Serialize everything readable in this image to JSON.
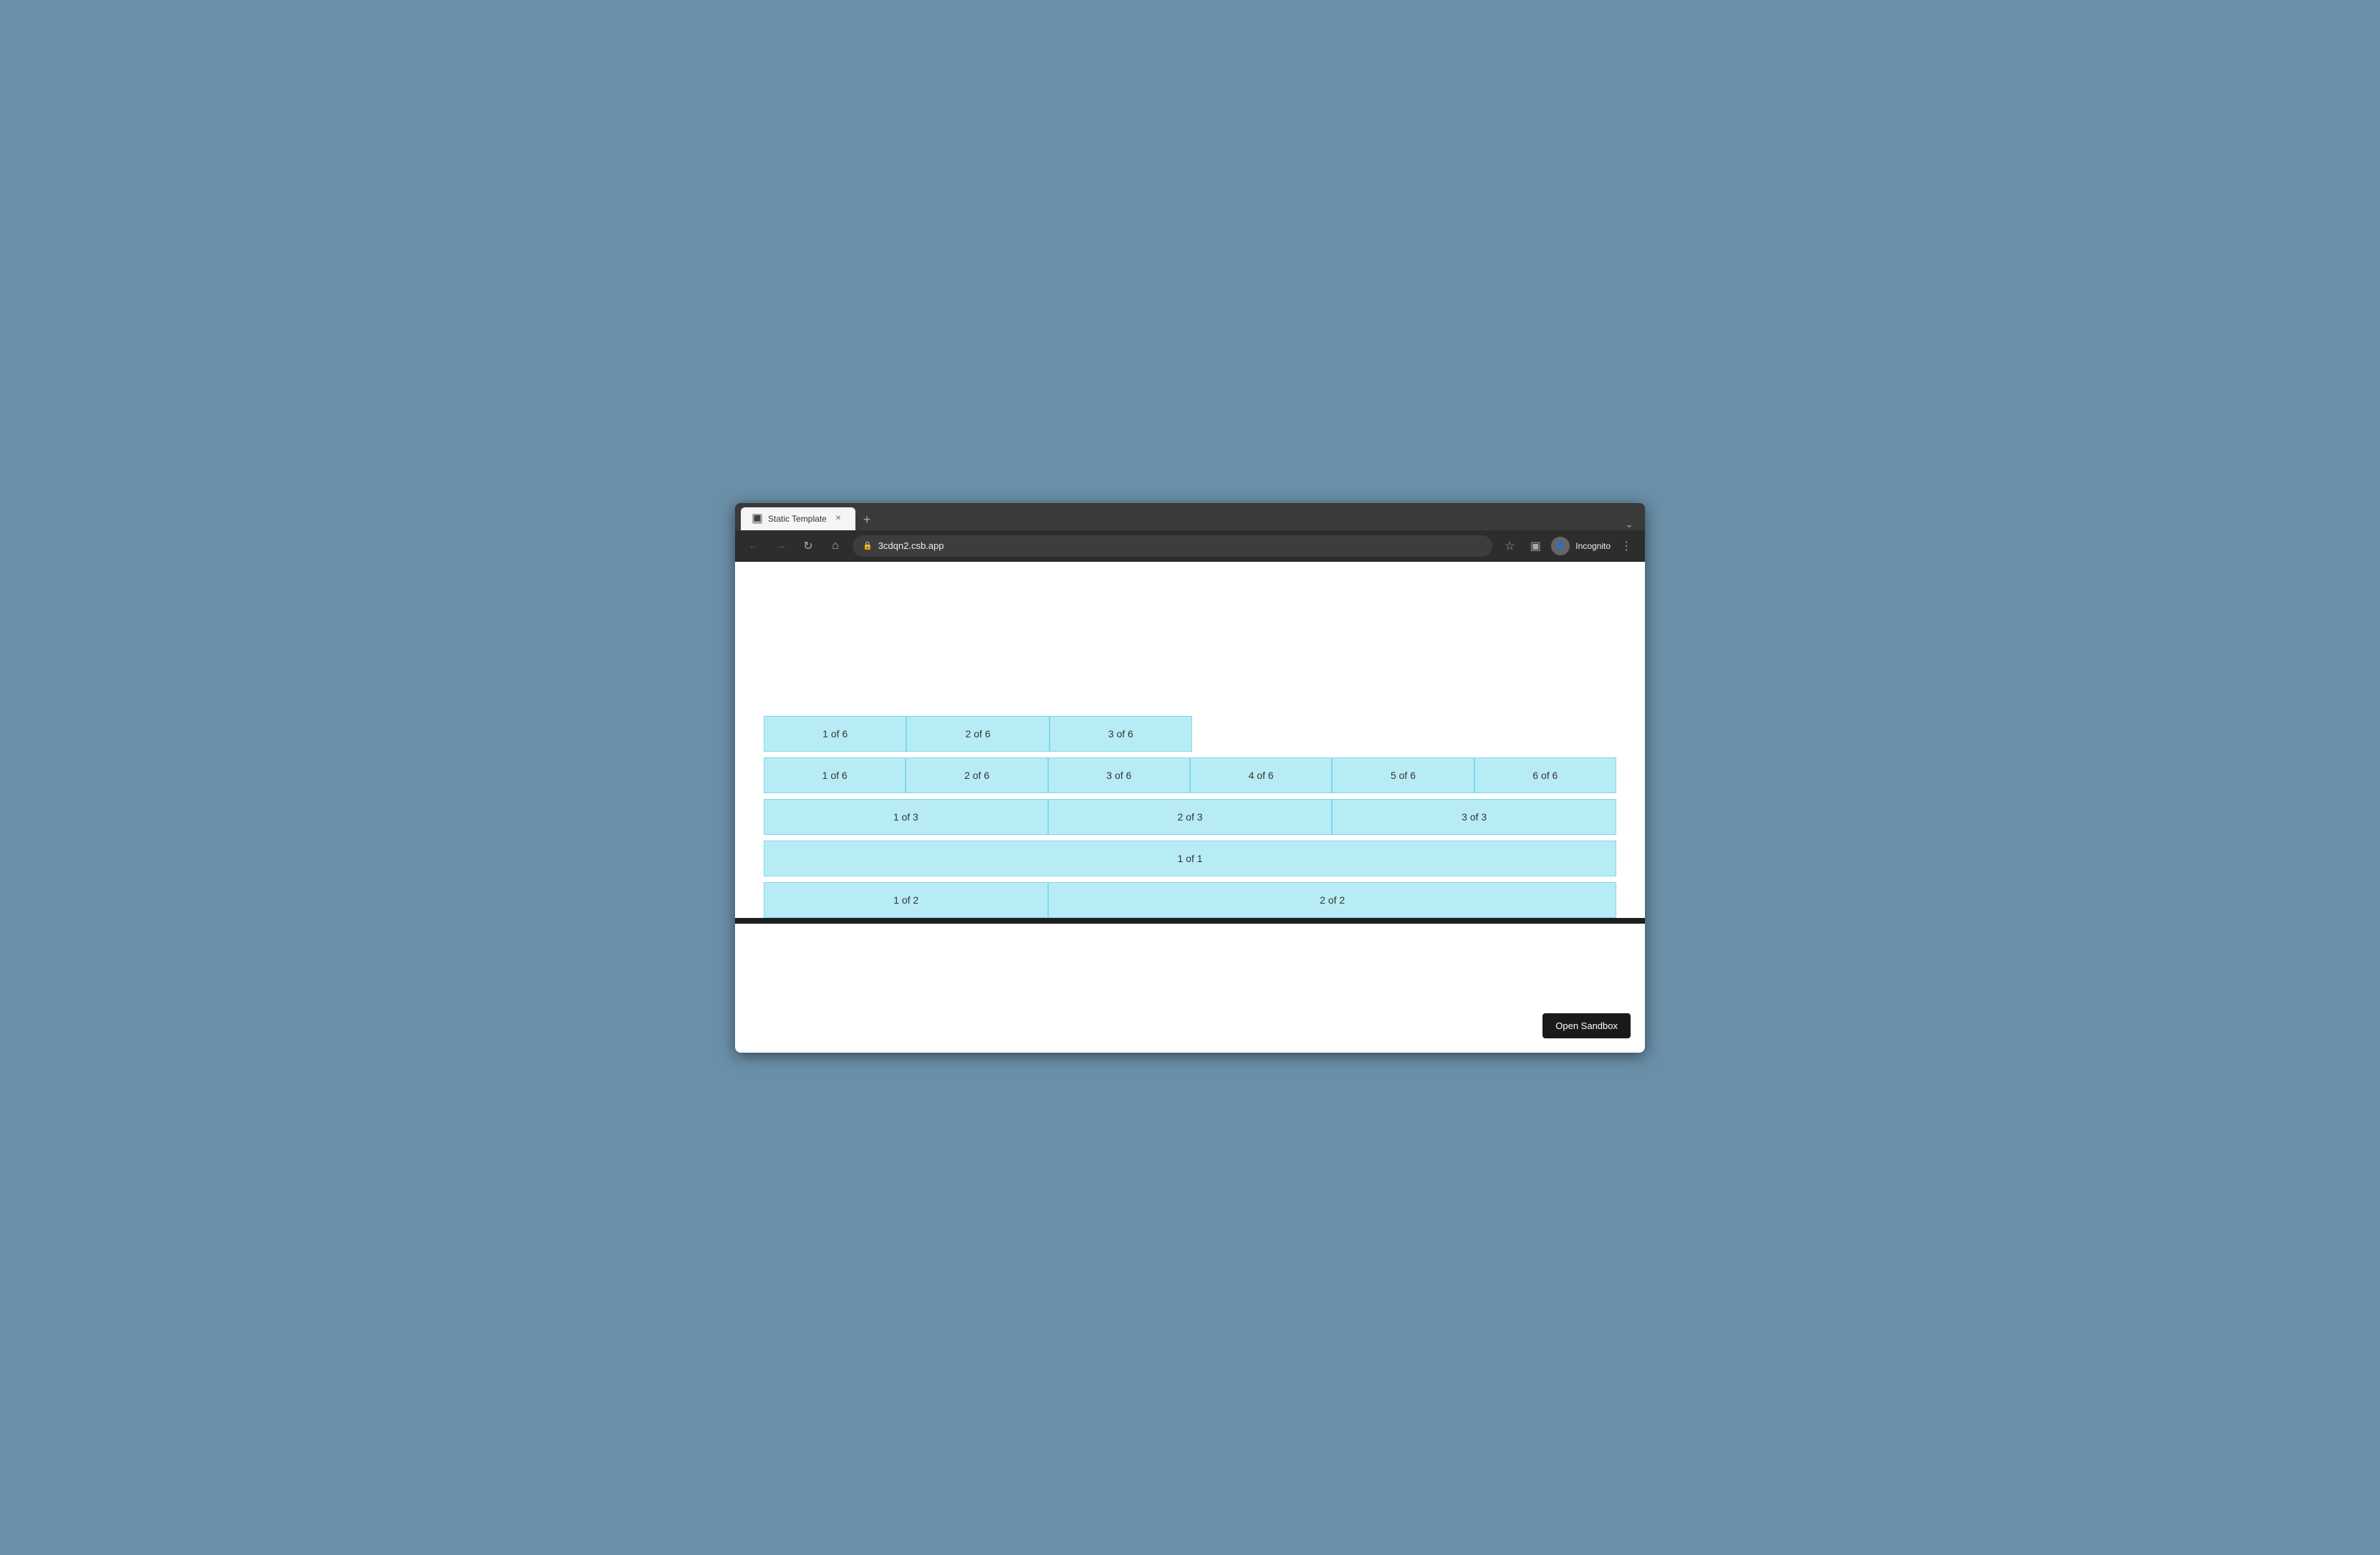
{
  "browser": {
    "tab_title": "Static Template",
    "url": "3cdqn2.csb.app",
    "incognito_label": "Incognito",
    "new_tab_btn": "+",
    "tab_menu_btn": "⌄"
  },
  "toolbar": {
    "open_sandbox_label": "Open Sandbox"
  },
  "rows": [
    {
      "id": "row1",
      "cells": [
        {
          "label": "1 of 6"
        },
        {
          "label": "2 of 6"
        },
        {
          "label": "3 of 6"
        }
      ]
    },
    {
      "id": "row2",
      "cells": [
        {
          "label": "1 of 6"
        },
        {
          "label": "2 of 6"
        },
        {
          "label": "3 of 6"
        },
        {
          "label": "4 of 6"
        },
        {
          "label": "5 of 6"
        },
        {
          "label": "6 of 6"
        }
      ]
    },
    {
      "id": "row3",
      "cells": [
        {
          "label": "1 of 3"
        },
        {
          "label": "2 of 3"
        },
        {
          "label": "3 of 3"
        }
      ]
    },
    {
      "id": "row4",
      "cells": [
        {
          "label": "1 of 1"
        }
      ]
    },
    {
      "id": "row5",
      "cells": [
        {
          "label": "1 of 2"
        },
        {
          "label": "2 of 2"
        }
      ]
    }
  ]
}
